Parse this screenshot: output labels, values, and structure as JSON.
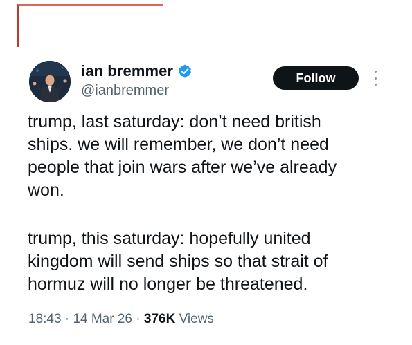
{
  "author": {
    "display_name": "ian bremmer",
    "handle": "@ianbremmer",
    "verified": true
  },
  "actions": {
    "follow_label": "Follow"
  },
  "tweet": {
    "paragraph_1": "trump, last saturday: don’t need british\nships. we will remember, we don’t need\npeople that join wars after we’ve already\nwon.",
    "paragraph_2": "trump, this saturday: hopefully united\nkingdom will send ships so that strait of\nhormuz will no longer be threatened."
  },
  "meta": {
    "time": "18:43",
    "separator": "·",
    "date": "14 Mar 26",
    "views_count": "376K",
    "views_label": "Views"
  },
  "colors": {
    "accent_verified": "#1d9bf0",
    "follow_button_bg": "#0f1419",
    "secondary_text": "#536471",
    "frame_red": "#c0392b"
  },
  "icons": {
    "verified": "verified-badge-icon",
    "more": "more-options-icon"
  }
}
